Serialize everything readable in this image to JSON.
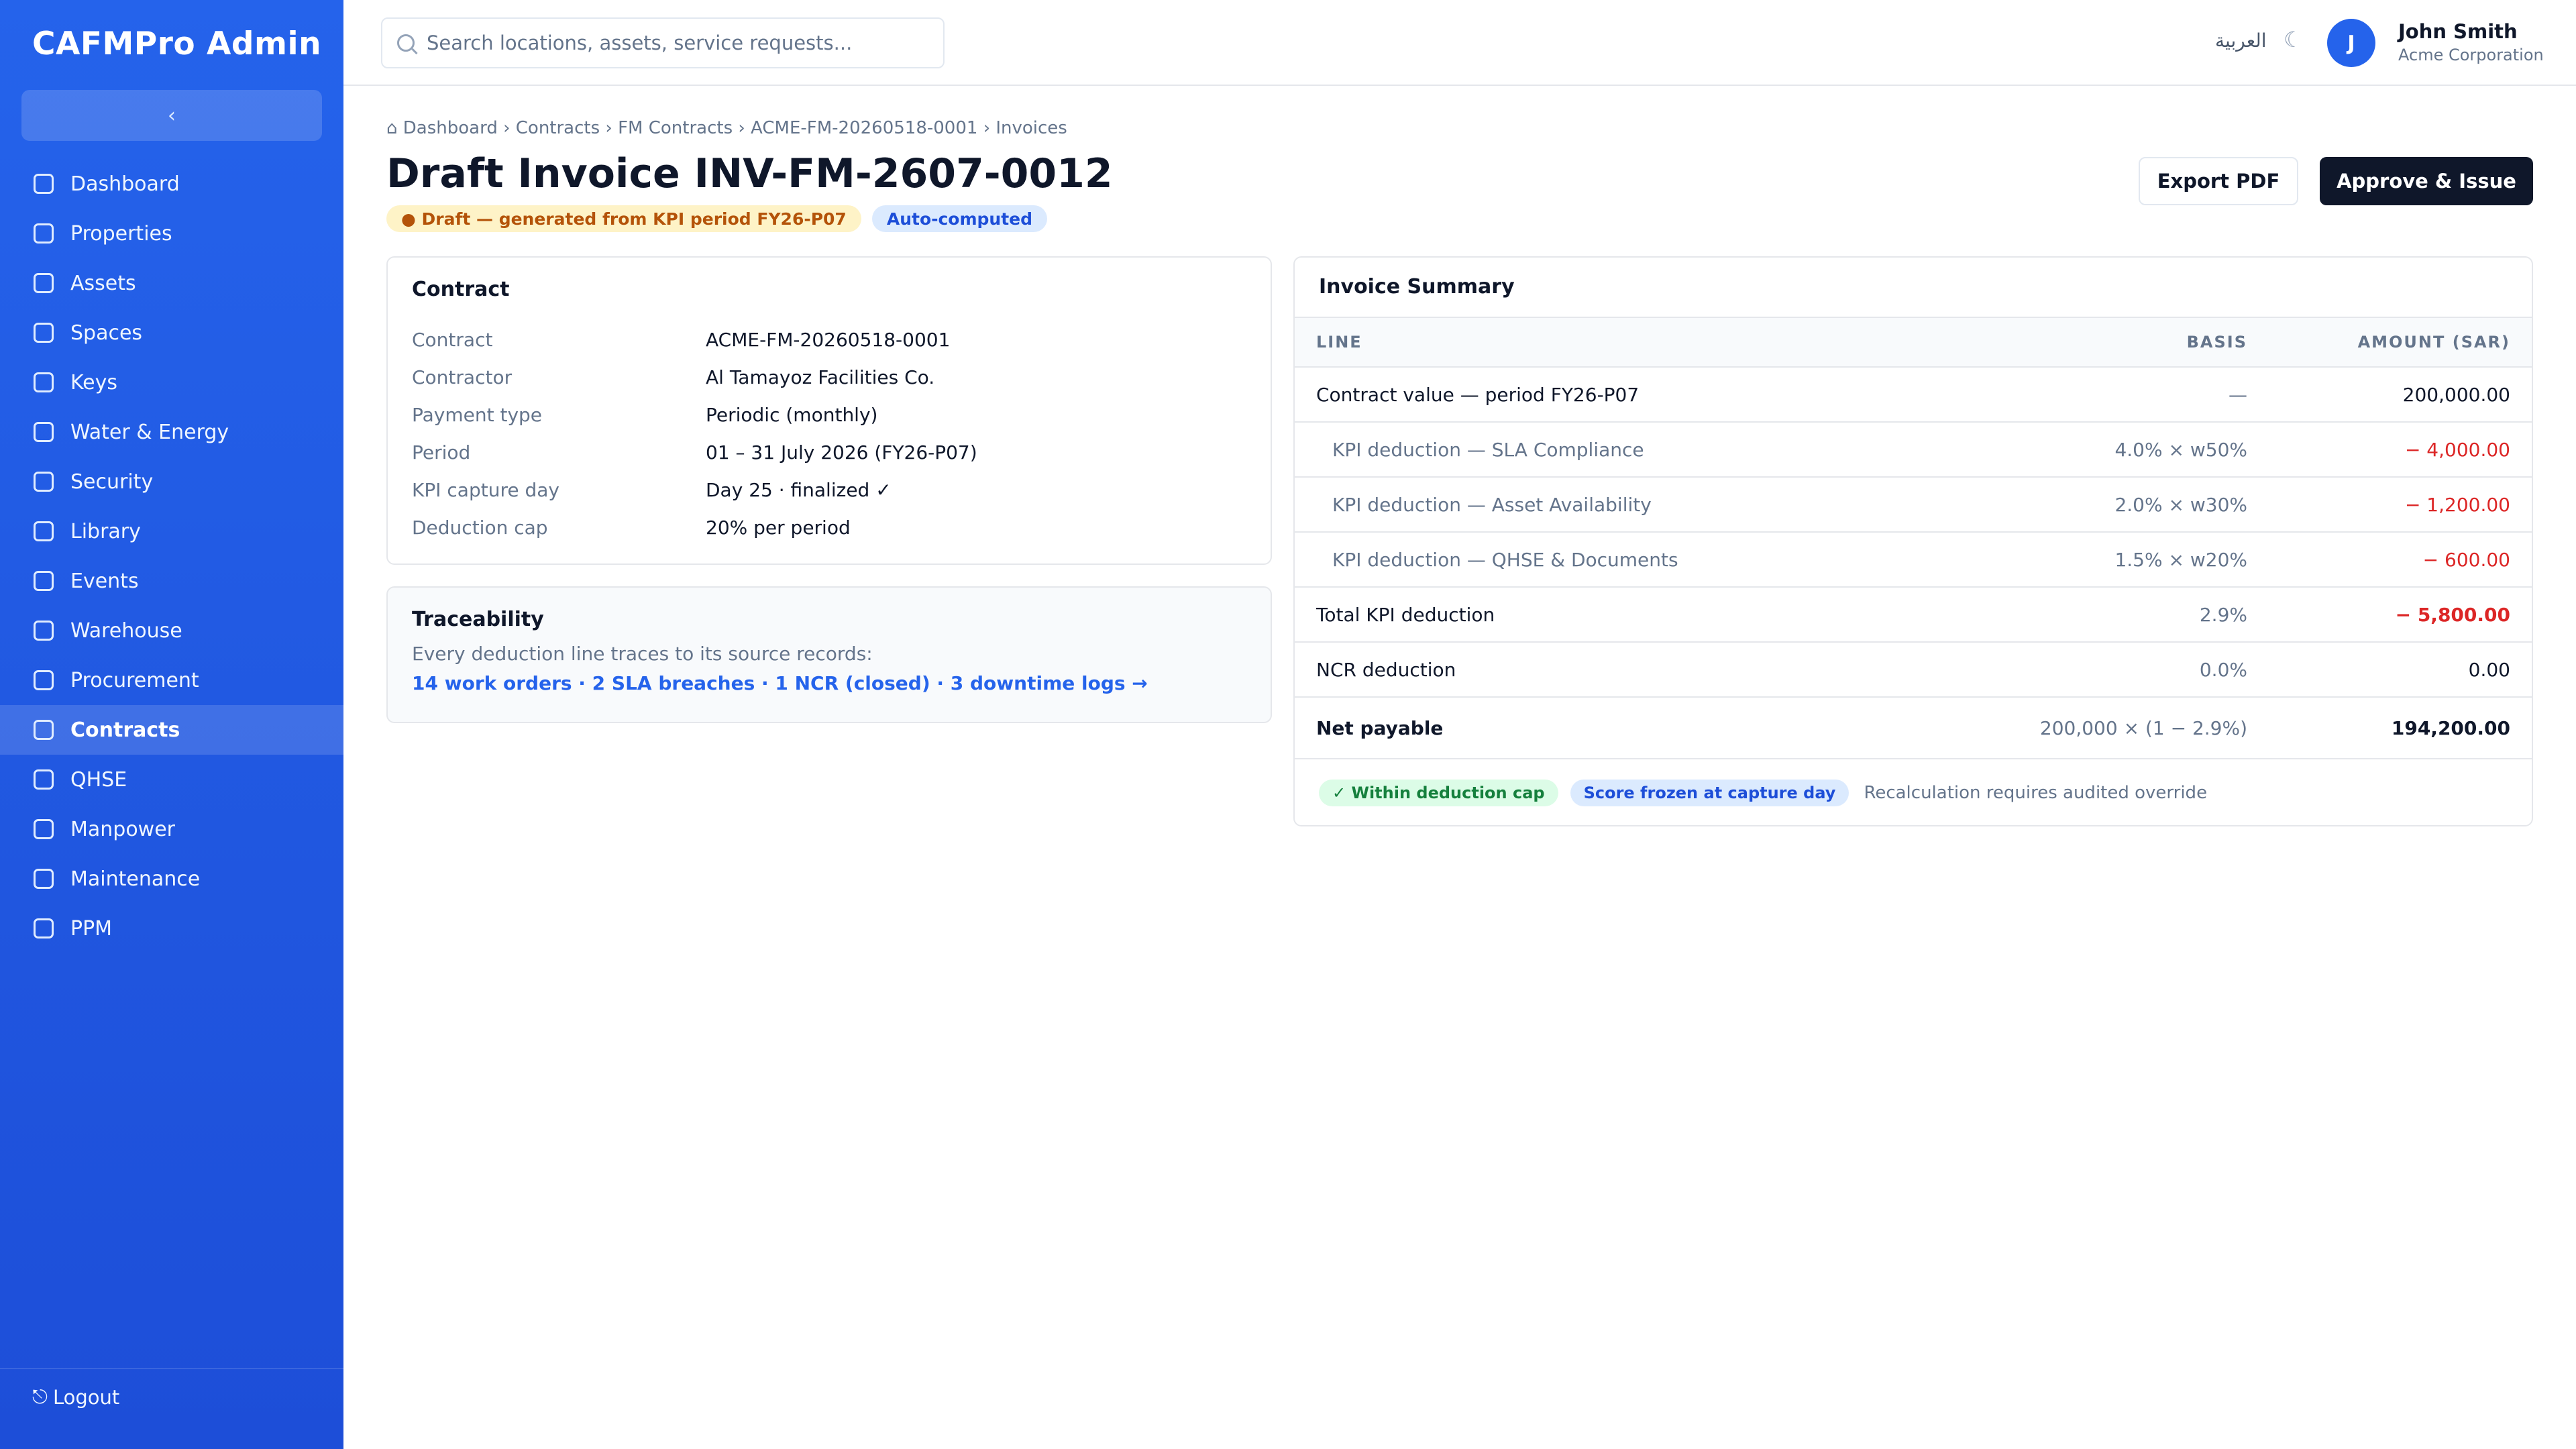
{
  "sidebar": {
    "brand": "CAFMPro Admin",
    "collapse_label": "‹",
    "items": [
      {
        "label": "Dashboard"
      },
      {
        "label": "Properties"
      },
      {
        "label": "Assets"
      },
      {
        "label": "Spaces"
      },
      {
        "label": "Keys"
      },
      {
        "label": "Water & Energy"
      },
      {
        "label": "Security"
      },
      {
        "label": "Library"
      },
      {
        "label": "Events"
      },
      {
        "label": "Warehouse"
      },
      {
        "label": "Procurement"
      },
      {
        "label": "Contracts"
      },
      {
        "label": "QHSE"
      },
      {
        "label": "Manpower"
      },
      {
        "label": "Maintenance"
      },
      {
        "label": "PPM"
      }
    ],
    "active_item": "Contracts",
    "logout_icon": "⎋",
    "logout_label": "Logout"
  },
  "topbar": {
    "search_placeholder": "Search locations, assets, service requests...",
    "language": "العربية",
    "theme_icon": "☾",
    "user": {
      "initial": "J",
      "name": "John Smith",
      "org": "Acme Corporation"
    }
  },
  "page": {
    "breadcrumb": "⌂ Dashboard › Contracts › FM Contracts › ACME-FM-20260518-0001 › Invoices",
    "title": "Draft Invoice INV-FM-2607-0012",
    "badge_draft": "● Draft — generated from KPI period FY26-P07",
    "badge_auto": "Auto-computed",
    "export_label": "Export PDF",
    "approve_label": "Approve & Issue"
  },
  "contract": {
    "title": "Contract",
    "rows": [
      {
        "label": "Contract",
        "value": "ACME-FM-20260518-0001"
      },
      {
        "label": "Contractor",
        "value": "Al Tamayoz Facilities Co."
      },
      {
        "label": "Payment type",
        "value": "Periodic (monthly)"
      },
      {
        "label": "Period",
        "value": "01 – 31 July 2026 (FY26-P07)"
      },
      {
        "label": "KPI capture day",
        "value": "Day 25 · finalized ✓"
      },
      {
        "label": "Deduction cap",
        "value": "20% per period"
      }
    ]
  },
  "traceability": {
    "title": "Traceability",
    "description": "Every deduction line traces to its source records:",
    "link": "14 work orders · 2 SLA breaches · 1 NCR (closed) · 3 downtime logs →"
  },
  "summary": {
    "title": "Invoice Summary",
    "columns": {
      "line": "LINE",
      "basis": "BASIS",
      "amount": "AMOUNT (SAR)"
    },
    "rows": [
      {
        "line": "Contract value — period FY26-P07",
        "basis": "—",
        "amount": "200,000.00"
      },
      {
        "line": "KPI deduction — SLA Compliance",
        "basis": "4.0% × w50%",
        "amount": "− 4,000.00"
      },
      {
        "line": "KPI deduction — Asset Availability",
        "basis": "2.0% × w30%",
        "amount": "− 1,200.00"
      },
      {
        "line": "KPI deduction — QHSE & Documents",
        "basis": "1.5% × w20%",
        "amount": "− 600.00"
      },
      {
        "line": "Total KPI deduction",
        "basis": "2.9%",
        "amount": "− 5,800.00"
      },
      {
        "line": "NCR deduction",
        "basis": "0.0%",
        "amount": "0.00"
      },
      {
        "line": "Net payable",
        "basis": "200,000 × (1 − 2.9%)",
        "amount": "194,200.00"
      }
    ],
    "badge_cap": "✓ Within deduction cap",
    "badge_frozen": "Score frozen at capture day",
    "note": "Recalculation requires audited override"
  },
  "colors": {
    "sidebar": "#2563eb",
    "primary_button": "#0f172a",
    "negative": "#dc2626",
    "link": "#2563eb"
  }
}
